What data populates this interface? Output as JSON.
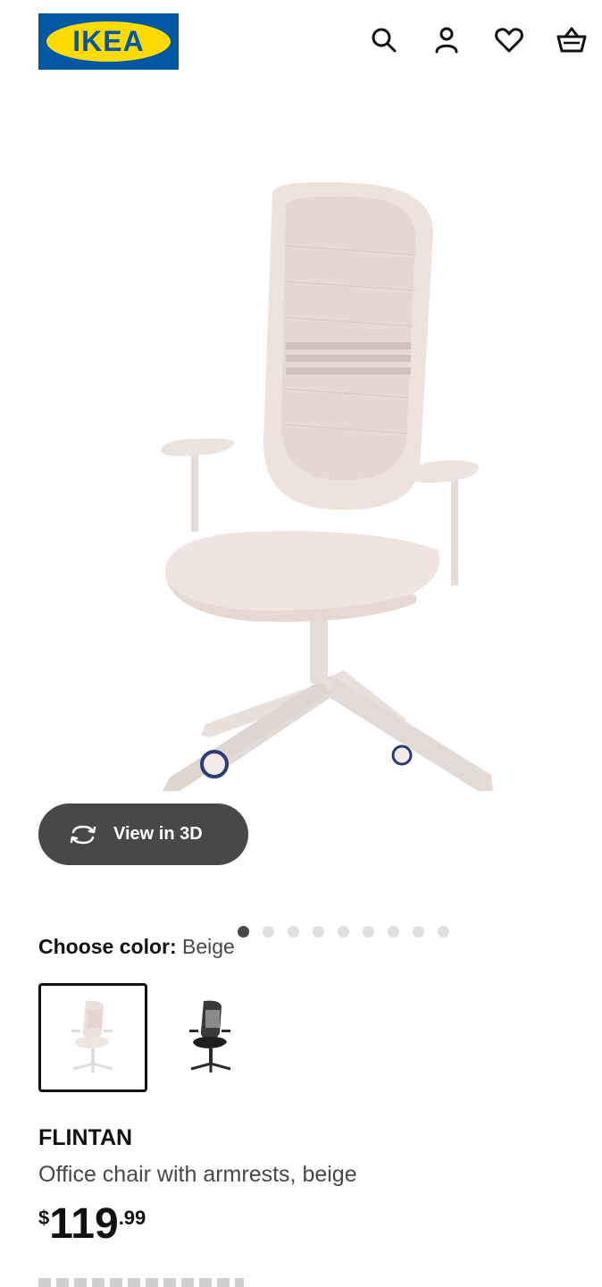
{
  "header": {
    "logo_text": "IKEA",
    "icons": [
      "search-icon",
      "account-icon",
      "favorites-icon",
      "basket-icon"
    ]
  },
  "gallery": {
    "view_3d_label": "View in 3D",
    "dot_count": 9,
    "active_dot": 1
  },
  "color": {
    "label": "Choose color:",
    "selected_value": "Beige",
    "swatches": [
      "beige",
      "black"
    ]
  },
  "product": {
    "name": "FLINTAN",
    "description": "Office chair with armrests, beige",
    "price_currency": "$",
    "price_whole": "119",
    "price_decimal": ".99"
  },
  "colors": {
    "brand_blue": "#0058a3",
    "brand_yellow": "#ffdb00",
    "text_primary": "#111111",
    "text_secondary": "#484848",
    "chair_beige": "#eee2dc"
  }
}
